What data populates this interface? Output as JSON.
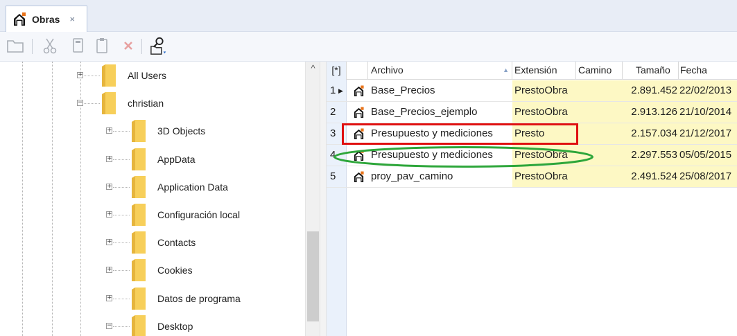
{
  "tab": {
    "label": "Obras",
    "close": "×"
  },
  "toolbar": {
    "buttons": [
      "open-folder-icon",
      "cut-icon",
      "copy-icon",
      "paste-icon",
      "delete-icon",
      "find-folder-icon"
    ]
  },
  "tree": {
    "nodes": [
      {
        "label": "All Users",
        "expander": "+"
      },
      {
        "label": "christian",
        "expander": "−"
      },
      {
        "label": "3D Objects",
        "expander": "+"
      },
      {
        "label": "AppData",
        "expander": "+"
      },
      {
        "label": "Application Data",
        "expander": "+"
      },
      {
        "label": "Configuración local",
        "expander": "+"
      },
      {
        "label": "Contacts",
        "expander": "+"
      },
      {
        "label": "Cookies",
        "expander": "+"
      },
      {
        "label": "Datos de programa",
        "expander": "+"
      },
      {
        "label": "Desktop",
        "expander": "−"
      }
    ],
    "scroll_up": "^"
  },
  "grid": {
    "corner": "[*]",
    "columns": [
      "Archivo",
      "Extensión",
      "Camino",
      "Tamaño",
      "Fecha"
    ],
    "rows": [
      {
        "n": "1",
        "archivo": "Base_Precios",
        "extension": "PrestoObra",
        "camino": "",
        "tamano": "2.891.452",
        "fecha": "22/02/2013"
      },
      {
        "n": "2",
        "archivo": "Base_Precios_ejemplo",
        "extension": "PrestoObra",
        "camino": "",
        "tamano": "2.913.126",
        "fecha": "21/10/2014"
      },
      {
        "n": "3",
        "archivo": "Presupuesto y mediciones",
        "extension": "Presto",
        "camino": "",
        "tamano": "2.157.034",
        "fecha": "21/12/2017"
      },
      {
        "n": "4",
        "archivo": "Presupuesto y mediciones",
        "extension": "PrestoObra",
        "camino": "",
        "tamano": "2.297.553",
        "fecha": "05/05/2015"
      },
      {
        "n": "5",
        "archivo": "proy_pav_camino",
        "extension": "PrestoObra",
        "camino": "",
        "tamano": "2.491.524",
        "fecha": "25/08/2017"
      }
    ],
    "colors": {
      "extension_bg": "#fdf8c4",
      "row_header_bg": "#eaf1fb",
      "highlight_red": "#e01010",
      "highlight_green": "#2da63a"
    }
  }
}
